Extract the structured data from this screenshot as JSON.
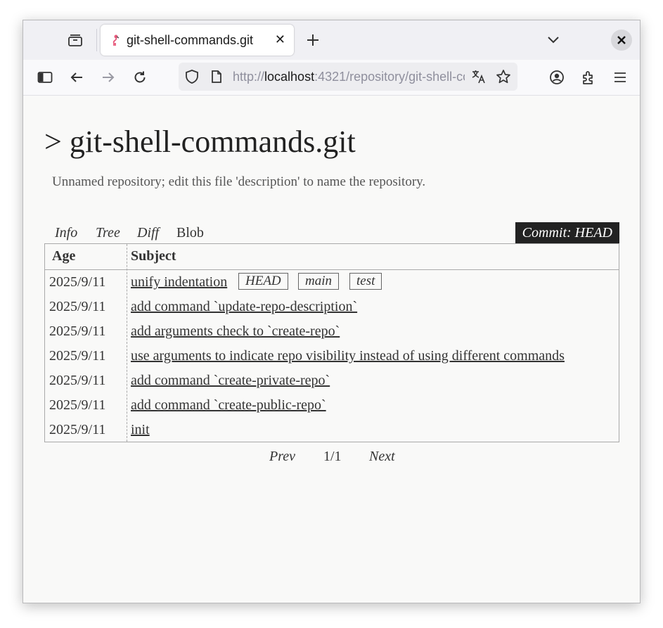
{
  "browser": {
    "tab": {
      "title": "git-shell-commands.git",
      "close_glyph": "✕"
    },
    "url": {
      "scheme": "http://",
      "host": "localhost",
      "rest": ":4321/repository/git-shell-commands.git"
    },
    "icons": [
      "tab-overview-icon",
      "flamingo-favicon-icon",
      "close-icon",
      "plus-icon",
      "chevron-down-icon",
      "window-close-icon",
      "sidebar-icon",
      "back-arrow-icon",
      "forward-arrow-icon",
      "reload-icon",
      "shield-icon",
      "page-icon",
      "translate-icon",
      "star-icon",
      "account-icon",
      "extensions-icon",
      "menu-icon"
    ]
  },
  "page": {
    "title": "> git-shell-commands.git",
    "description": "Unnamed repository; edit this file 'description' to name the repository."
  },
  "view_tabs": [
    {
      "label": "Info"
    },
    {
      "label": "Tree"
    },
    {
      "label": "Diff"
    },
    {
      "label": "Blob"
    }
  ],
  "commit_label": "Commit: HEAD",
  "log": {
    "headers": {
      "age": "Age",
      "subject": "Subject"
    },
    "rows": [
      {
        "age": "2025/9/11",
        "subject": "unify indentation",
        "refs": [
          "HEAD",
          "main",
          "test"
        ]
      },
      {
        "age": "2025/9/11",
        "subject": "add command `update-repo-description`"
      },
      {
        "age": "2025/9/11",
        "subject": "add arguments check to `create-repo`"
      },
      {
        "age": "2025/9/11",
        "subject": "use arguments to indicate repo visibility instead of using different commands"
      },
      {
        "age": "2025/9/11",
        "subject": "add command `create-private-repo`"
      },
      {
        "age": "2025/9/11",
        "subject": "add command `create-public-repo`"
      },
      {
        "age": "2025/9/11",
        "subject": "init"
      }
    ]
  },
  "pager": {
    "prev": "Prev",
    "page": "1/1",
    "next": "Next"
  }
}
